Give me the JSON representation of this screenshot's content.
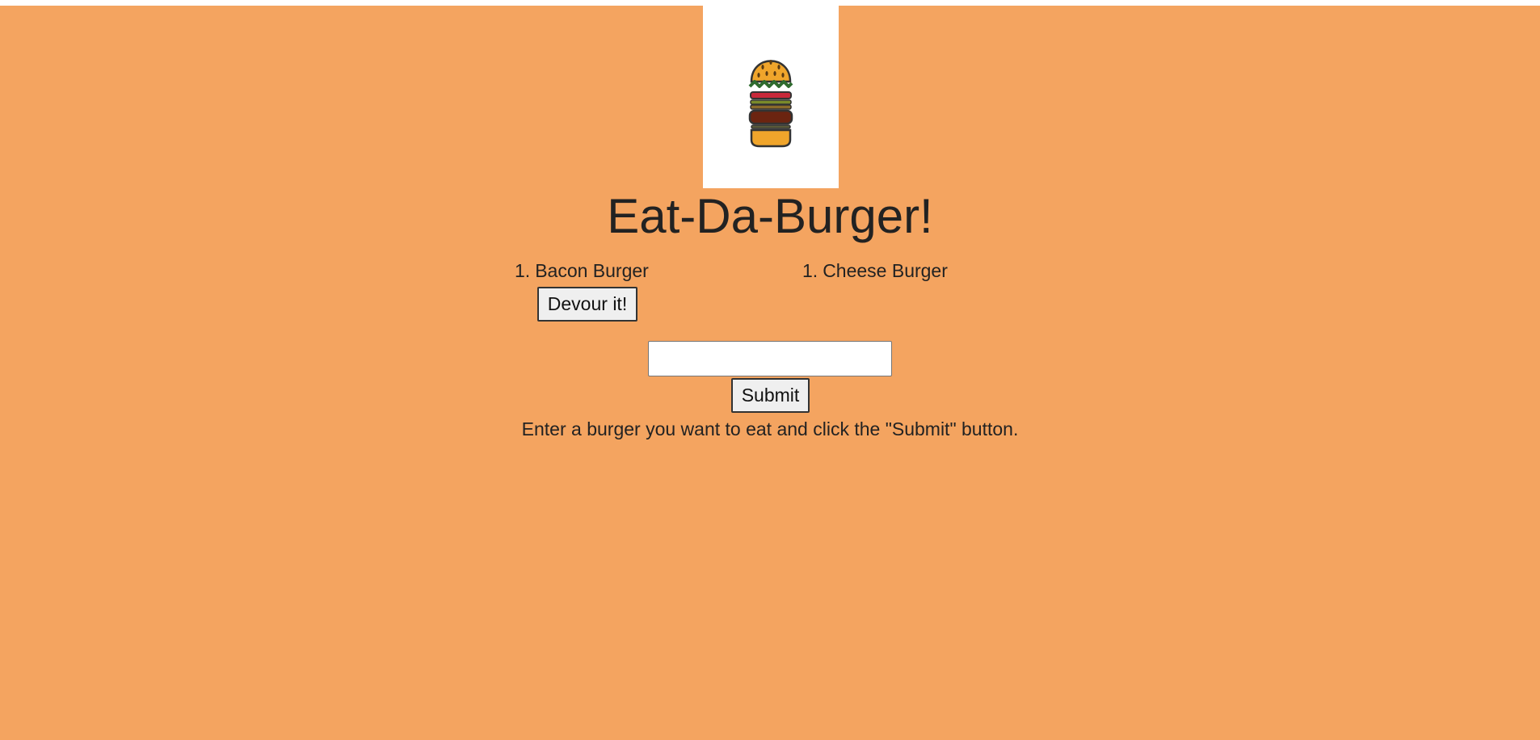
{
  "page": {
    "background_color": "#f4a460",
    "title": "Eat-Da-Burger!",
    "logo_icon": "hamburger-icon"
  },
  "uneaten_burgers": [
    {
      "number": "1.",
      "name": "Bacon Burger",
      "button_label": "Devour it!"
    }
  ],
  "devoured_burgers": [
    {
      "number": "1.",
      "name": "Cheese Burger"
    }
  ],
  "form": {
    "input_value": "",
    "input_placeholder": "",
    "submit_label": "Submit",
    "instructions": "Enter a burger you want to eat and click the \"Submit\" button."
  }
}
